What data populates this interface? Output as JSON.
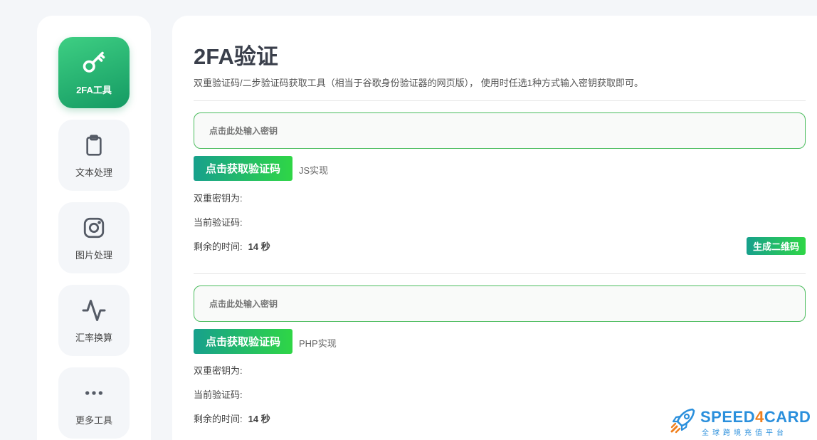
{
  "sidebar": {
    "items": [
      {
        "label": "2FA工具",
        "icon": "key-icon",
        "active": true
      },
      {
        "label": "文本处理",
        "icon": "clipboard-icon",
        "active": false
      },
      {
        "label": "图片处理",
        "icon": "instagram-icon",
        "active": false
      },
      {
        "label": "汇率换算",
        "icon": "activity-icon",
        "active": false
      },
      {
        "label": "更多工具",
        "icon": "more-dots-icon",
        "active": false
      }
    ]
  },
  "main": {
    "title": "2FA验证",
    "subtitle": "双重验证码/二步验证码获取工具（相当于谷歌身份验证器的网页版），  使用时任选1种方式输入密钥获取即可。",
    "sections": [
      {
        "input_placeholder": "点击此处输入密钥",
        "button_label": "点击获取验证码",
        "impl_label": "JS实现",
        "secret_label": "双重密钥为:",
        "code_label": "当前验证码:",
        "remaining_label": "剩余的时间:",
        "remaining_value": "14 秒",
        "qr_button_label": "生成二维码"
      },
      {
        "input_placeholder": "点击此处输入密钥",
        "button_label": "点击获取验证码",
        "impl_label": "PHP实现",
        "secret_label": "双重密钥为:",
        "code_label": "当前验证码:",
        "remaining_label": "剩余的时间:",
        "remaining_value": "14 秒"
      }
    ]
  },
  "watermark": {
    "brand_prefix": "SPEED",
    "brand_digit": "4",
    "brand_suffix": "CARD",
    "tagline": "全球跨境充值平台"
  },
  "colors": {
    "accent_green": "#149a63",
    "button_gradient_start": "#17a08c",
    "button_gradient_end": "#2fd646",
    "input_border": "#4cbc5e",
    "brand_blue": "#2a8fdc",
    "brand_orange": "#f07f1d"
  }
}
